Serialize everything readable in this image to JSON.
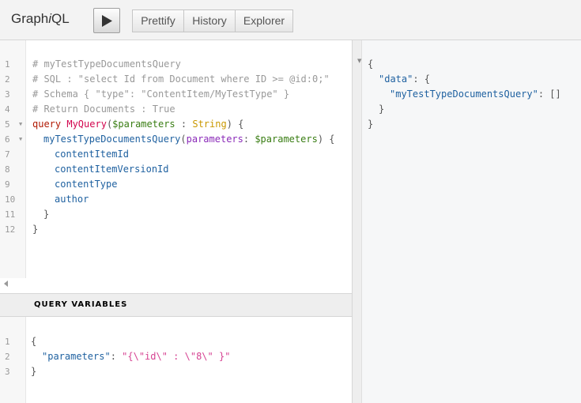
{
  "topbar": {
    "logo_prefix": "Graph",
    "logo_italic": "i",
    "logo_suffix": "QL",
    "execute_icon": "play-icon",
    "buttons": {
      "prettify": "Prettify",
      "history": "History",
      "explorer": "Explorer"
    }
  },
  "query_editor": {
    "line_numbers": [
      "1",
      "2",
      "3",
      "4",
      "5",
      "6",
      "7",
      "8",
      "9",
      "10",
      "11",
      "12"
    ],
    "lines": {
      "l1": "# myTestTypeDocumentsQuery",
      "l2": "# SQL : \"select Id from Document where ID >= @id:0;\"",
      "l3": "# Schema { \"type\": \"ContentItem/MyTestType\" }",
      "l4": "# Return Documents : True",
      "l5_kw": "query",
      "l5_name": "MyQuery",
      "l5_open": "(",
      "l5_var": "$parameters",
      "l5_colon": " : ",
      "l5_type": "String",
      "l5_close": ") {",
      "l6_field": "myTestTypeDocumentsQuery",
      "l6_open": "(",
      "l6_arg": "parameters",
      "l6_colon": ": ",
      "l6_var": "$parameters",
      "l6_close": ") {",
      "l7": "contentItemId",
      "l8": "contentItemVersionId",
      "l9": "contentType",
      "l10": "author",
      "l11": "}",
      "l12": "}"
    }
  },
  "variables": {
    "title": "QUERY VARIABLES",
    "line_numbers": [
      "1",
      "2",
      "3"
    ],
    "l1": "{",
    "l2_key": "\"parameters\"",
    "l2_colon": ": ",
    "l2_value": "\"{\\\"id\\\" : \\\"8\\\" }\"",
    "l3": "}"
  },
  "result": {
    "l1": "{",
    "l2_key": "\"data\"",
    "l2_rest": ": {",
    "l3_key": "\"myTestTypeDocumentsQuery\"",
    "l3_rest": ": []",
    "l4": "}",
    "l5": "}"
  }
}
